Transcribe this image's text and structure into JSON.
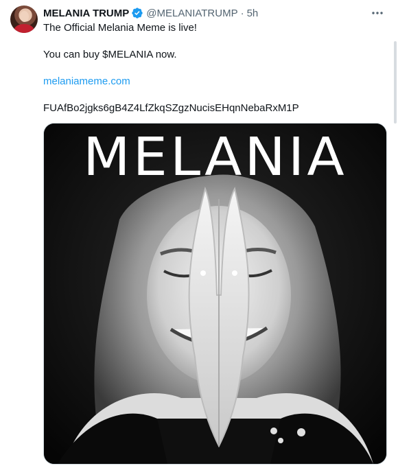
{
  "author": {
    "name": "MELANIA TRUMP",
    "handle": "@MELANIATRUMP",
    "separator": "·",
    "time": "5h",
    "verified_color": "#1d9bf0"
  },
  "tweet": {
    "line1": "The Official Melania Meme is live!",
    "line2": "You can buy $MELANIA now.",
    "link": "melaniameme.com",
    "contract": "FUAfBo2jgks6gB4Z4LfZkqSZgzNucisEHqnNebaRxM1P"
  },
  "media": {
    "title": "MELANIA"
  },
  "icons": {
    "more": "more-horizontal-icon",
    "verified": "verified-badge-icon"
  },
  "colors": {
    "text": "#0f1419",
    "secondary": "#536471",
    "link": "#1d9bf0"
  }
}
